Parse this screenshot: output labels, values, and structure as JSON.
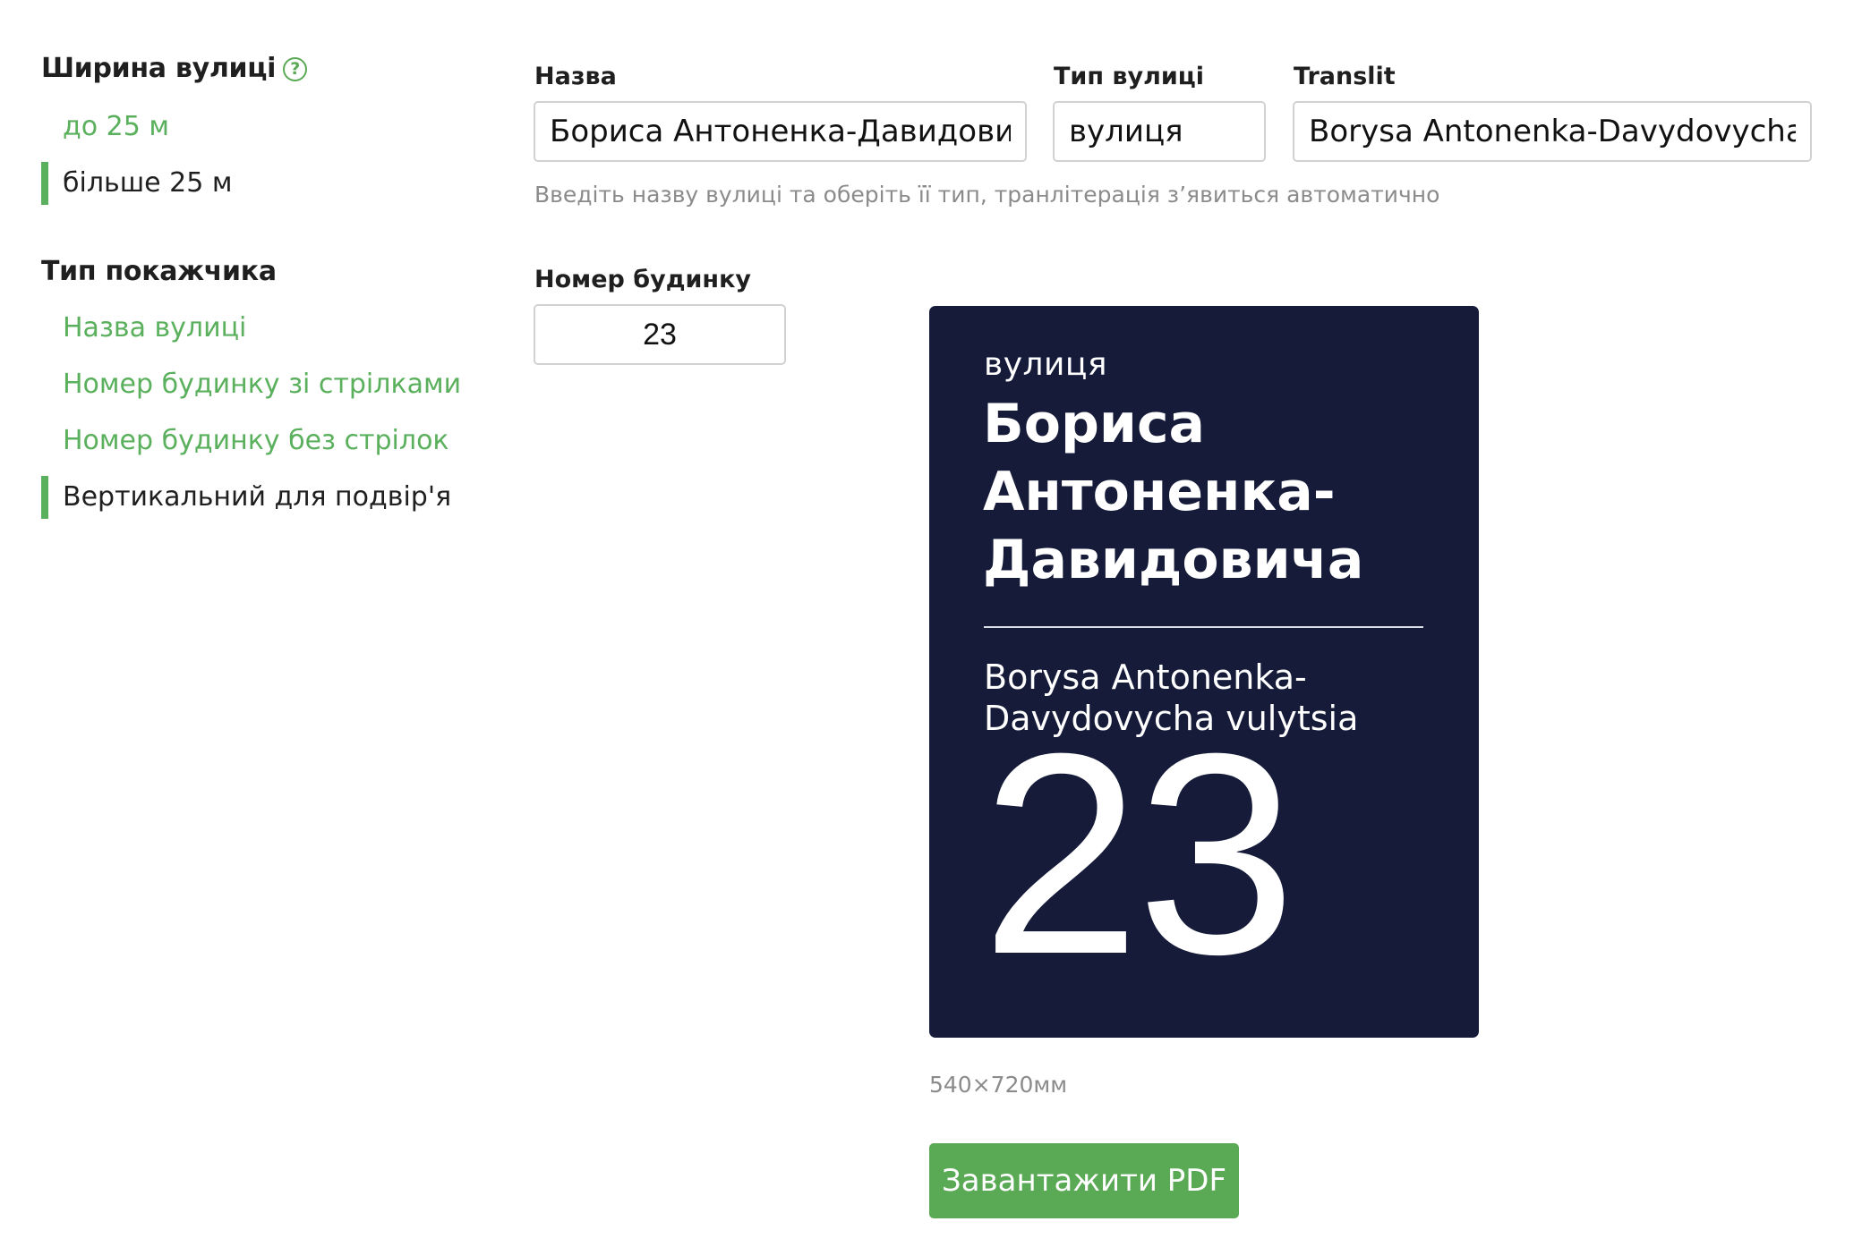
{
  "sidebar": {
    "width_title": "Ширина вулиці",
    "help_icon": "question-circle-icon",
    "help_glyph": "?",
    "width_options": [
      {
        "label": "до 25 м",
        "active": false
      },
      {
        "label": "більше 25 м",
        "active": true
      }
    ],
    "type_title": "Тип покажчика",
    "type_options": [
      {
        "label": "Назва вулиці",
        "active": false
      },
      {
        "label": "Номер будинку зі стрілками",
        "active": false
      },
      {
        "label": "Номер будинку без стрілок",
        "active": false
      },
      {
        "label": "Вертикальний для подвір'я",
        "active": true
      }
    ]
  },
  "form": {
    "name_label": "Назва",
    "name_value": "Бориса Антоненка-Давидовича",
    "street_type_label": "Тип вулиці",
    "street_type_value": "вулиця",
    "translit_label": "Translit",
    "translit_value": "Borysa Antonenka-Davydovycha vulytsia",
    "hint": "Введіть назву вулиці та оберіть її тип, транлітерація з’явиться автоматично",
    "house_number_label": "Номер будинку",
    "house_number_value": "23"
  },
  "sign": {
    "street_type": "вулиця",
    "name_line1": "Бориса",
    "name_line2": "Антоненка-",
    "name_line3": "Давидовича",
    "translit_line1": "Borysa Antonenka-",
    "translit_line2": "Davydovycha vulytsia",
    "number": "23",
    "size": "540×720мм"
  },
  "actions": {
    "download_label": "Завантажити PDF"
  },
  "colors": {
    "accent": "#5aa955",
    "sign_background": "#151b39",
    "muted_text": "#8b8b8b"
  }
}
